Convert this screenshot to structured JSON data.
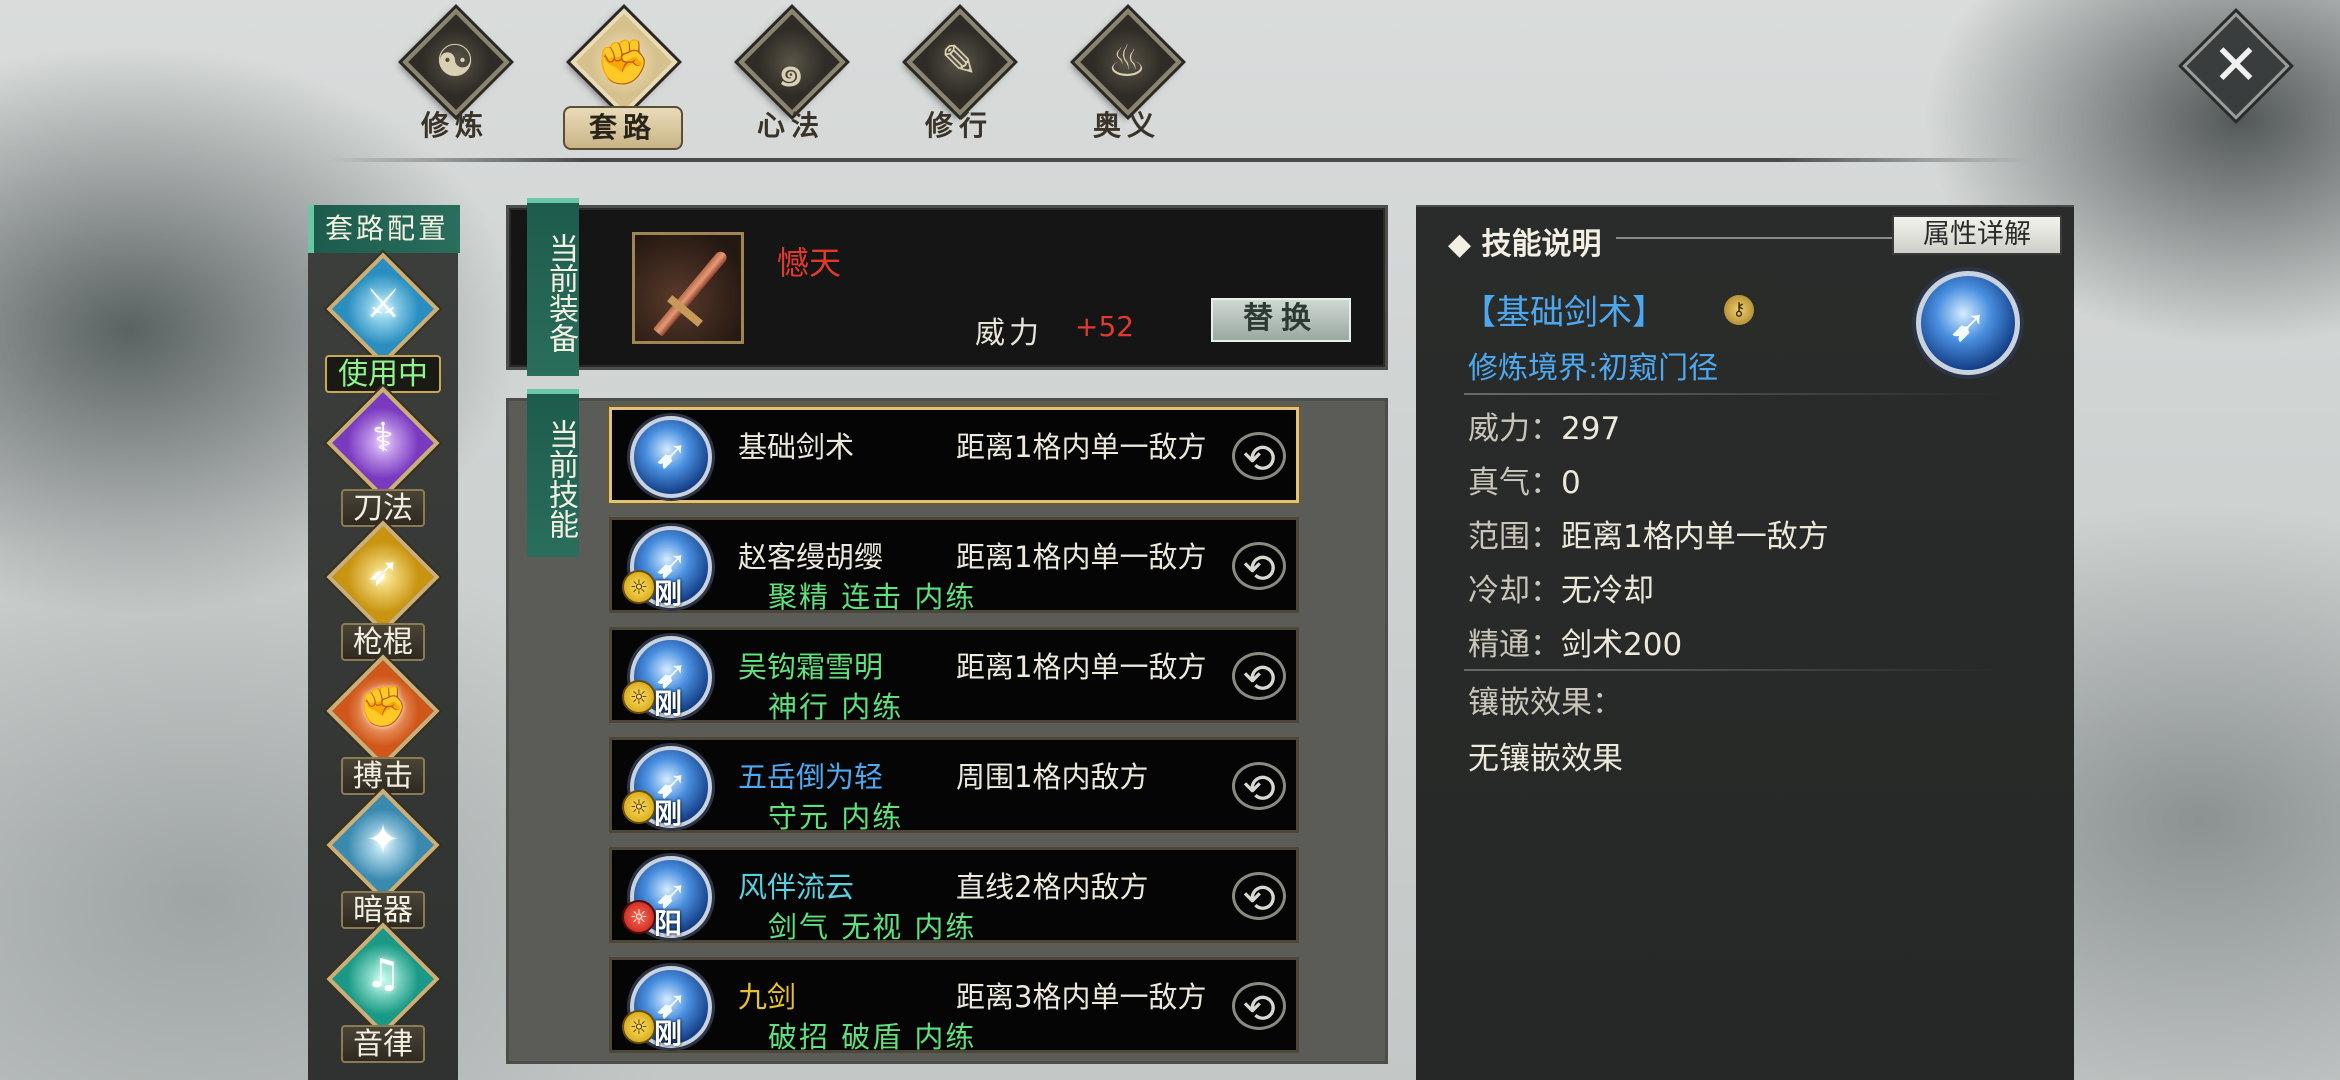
{
  "top_tabs": [
    {
      "label": "修炼",
      "icon": "yin-yang-icon",
      "active": false
    },
    {
      "label": "套路",
      "icon": "fist-icon",
      "active": true
    },
    {
      "label": "心法",
      "icon": "swirl-icon",
      "active": false
    },
    {
      "label": "修行",
      "icon": "scroll-icon",
      "active": false
    },
    {
      "label": "奥义",
      "icon": "flame-icon",
      "active": false
    }
  ],
  "close_button": {
    "icon": "close-icon",
    "glyph": "✕"
  },
  "category": {
    "header": "套路配置",
    "items": [
      {
        "label": "使用中",
        "icon": "sword-icon",
        "active": true
      },
      {
        "label": "刀法",
        "icon": "blade-icon",
        "active": false
      },
      {
        "label": "枪棍",
        "icon": "spear-icon",
        "active": false
      },
      {
        "label": "搏击",
        "icon": "fist-icon",
        "active": false
      },
      {
        "label": "暗器",
        "icon": "dart-icon",
        "active": false
      },
      {
        "label": "音律",
        "icon": "lute-icon",
        "active": false
      }
    ]
  },
  "equipment": {
    "tab_label": "当前装备",
    "weapon_name": "憾天",
    "power_label": "威力",
    "power_value": "+52",
    "replace_label": "替换"
  },
  "skills": {
    "tab_label": "当前技能",
    "rows": [
      {
        "name": "基础剑术",
        "name_color": "white",
        "range": "距离1格内单一敌方",
        "tags": "",
        "attr": "",
        "badge": "",
        "selected": true
      },
      {
        "name": "赵客缦胡缨",
        "name_color": "white",
        "range": "距离1格内单一敌方",
        "tags": "聚精  连击  内练",
        "attr": "刚",
        "badge": "yellow",
        "selected": false
      },
      {
        "name": "吴钩霜雪明",
        "name_color": "green",
        "range": "距离1格内单一敌方",
        "tags": "神行  内练",
        "attr": "刚",
        "badge": "yellow",
        "selected": false
      },
      {
        "name": "五岳倒为轻",
        "name_color": "blue",
        "range": "周围1格内敌方",
        "tags": "守元  内练",
        "attr": "刚",
        "badge": "yellow",
        "selected": false
      },
      {
        "name": "风伴流云",
        "name_color": "cyan",
        "range": "直线2格内敌方",
        "tags": "剑气  无视  内练",
        "attr": "阳",
        "badge": "red",
        "selected": false
      },
      {
        "name": "九剑",
        "name_color": "gold",
        "range": "距离3格内单一敌方",
        "tags": "破招  破盾  内练",
        "attr": "刚",
        "badge": "yellow",
        "selected": false
      }
    ]
  },
  "description": {
    "title": "技能说明",
    "attr_detail_button": "属性详解",
    "skill_name": "【基础剑术】",
    "realm": "修炼境界:初窥门径",
    "stats": [
      {
        "key": "威力：",
        "value": "297"
      },
      {
        "key": "真气：",
        "value": "0"
      },
      {
        "key": "范围：",
        "value": "距离1格内单一敌方"
      },
      {
        "key": "冷却：",
        "value": "无冷却"
      },
      {
        "key": "精通：",
        "value": "剑术200"
      }
    ],
    "inlay_label": "镶嵌效果：",
    "inlay_value": "无镶嵌效果"
  },
  "colors": {
    "accent_green": "#5fe07a",
    "accent_blue": "#4ea8f0",
    "accent_red": "#e03a2e",
    "accent_gold": "#e8c030",
    "tab_teal": "#1d5c4c"
  }
}
